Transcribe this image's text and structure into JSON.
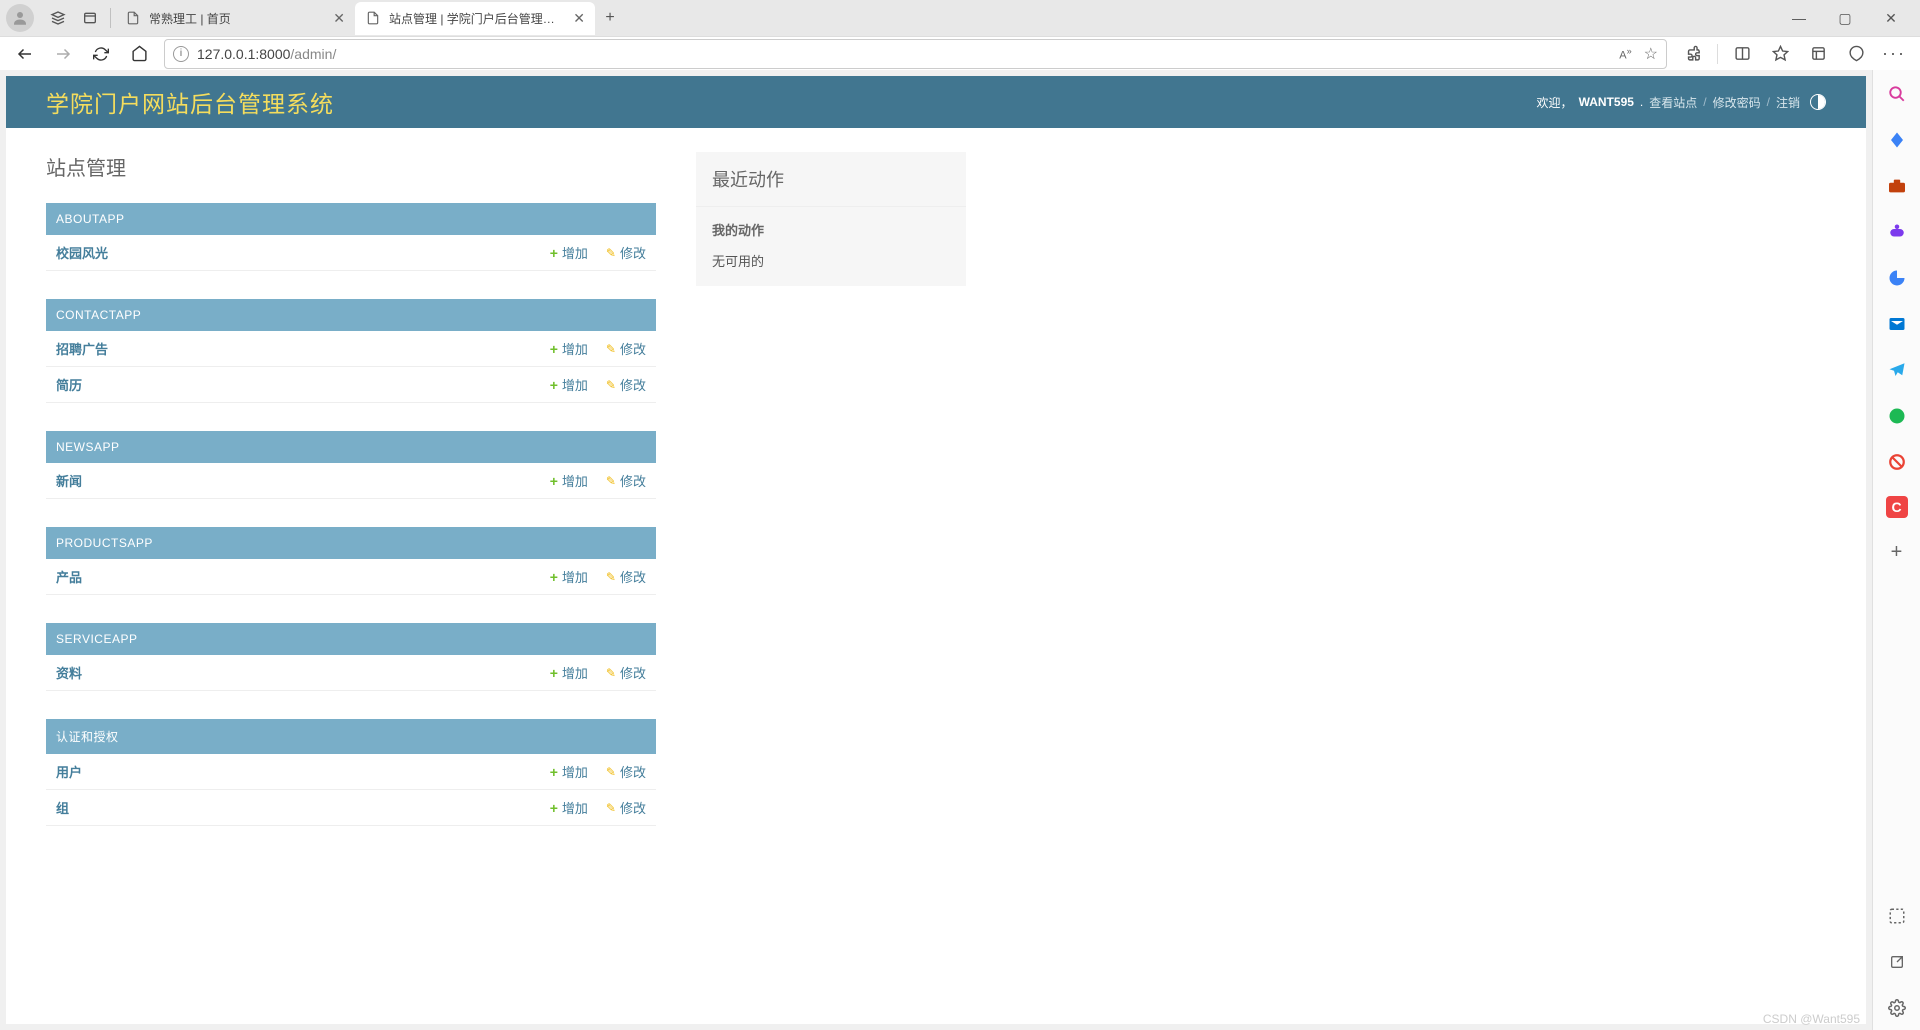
{
  "browser": {
    "tabs": [
      {
        "title": "常熟理工 | 首页",
        "active": false
      },
      {
        "title": "站点管理 | 学院门户后台管理系统",
        "active": true
      }
    ],
    "url_host": "127.0.0.1:8000",
    "url_path": "/admin/",
    "aa_label": "A",
    "win": {
      "min": "—",
      "max": "▢",
      "close": "✕"
    }
  },
  "admin": {
    "site_title": "学院门户网站后台管理系统",
    "welcome": "欢迎，",
    "username": "WANT595",
    "links": {
      "view_site": "查看站点",
      "change_password": "修改密码",
      "logout": "注销"
    },
    "page_heading": "站点管理",
    "add_label": "增加",
    "change_label": "修改",
    "apps": [
      {
        "name": "ABOUTAPP",
        "models": [
          {
            "name": "校园风光"
          }
        ]
      },
      {
        "name": "CONTACTAPP",
        "models": [
          {
            "name": "招聘广告"
          },
          {
            "name": "简历"
          }
        ]
      },
      {
        "name": "NEWSAPP",
        "models": [
          {
            "name": "新闻"
          }
        ]
      },
      {
        "name": "PRODUCTSAPP",
        "models": [
          {
            "name": "产品"
          }
        ]
      },
      {
        "name": "SERVICEAPP",
        "models": [
          {
            "name": "资料"
          }
        ]
      },
      {
        "name": "认证和授权",
        "models": [
          {
            "name": "用户"
          },
          {
            "name": "组"
          }
        ]
      }
    ],
    "recent": {
      "title": "最近动作",
      "my_actions": "我的动作",
      "none": "无可用的"
    }
  },
  "watermark": "CSDN @Want595"
}
